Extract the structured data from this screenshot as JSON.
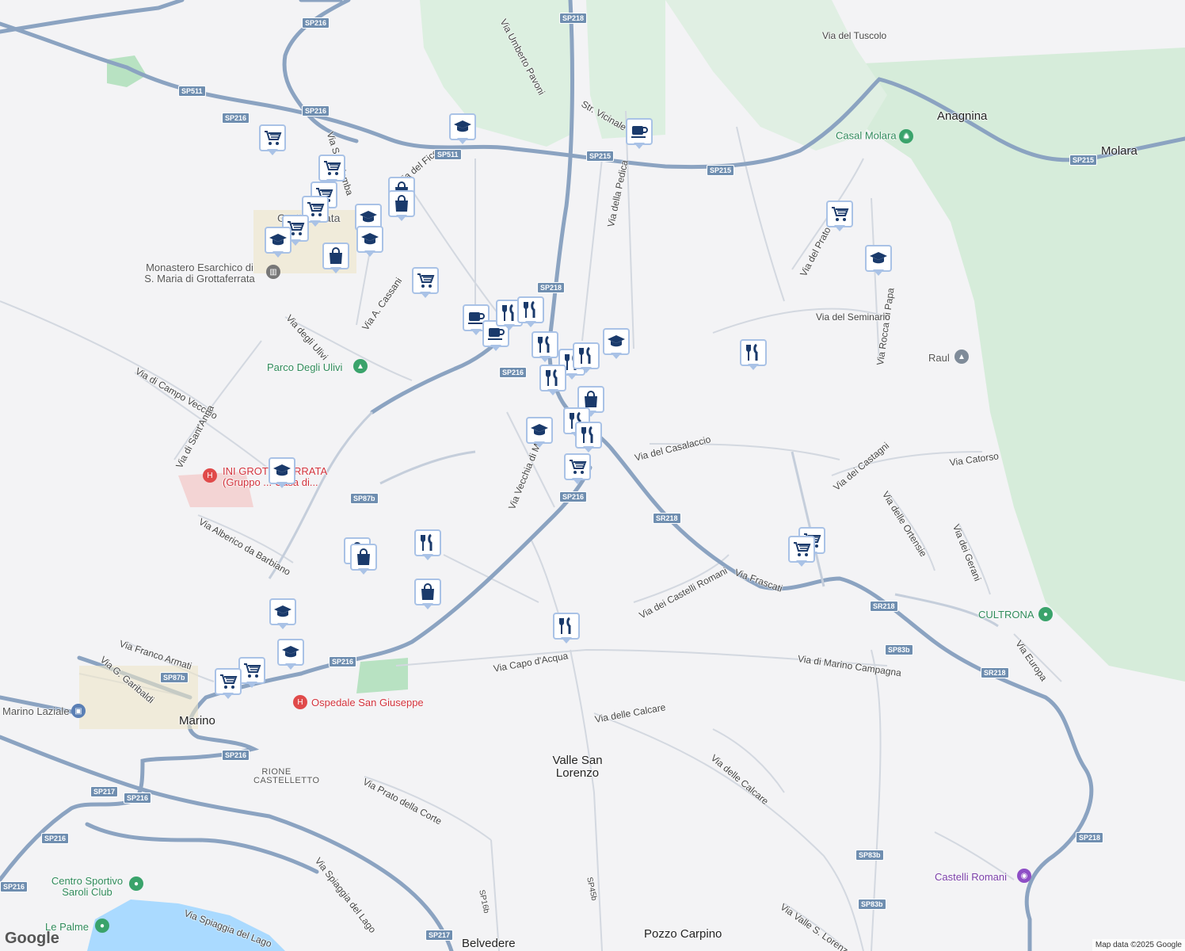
{
  "map": {
    "attribution": "Map data ©2025 Google",
    "logo": "Google"
  },
  "towns": [
    {
      "name": "Anagnina"
    },
    {
      "name": "Molara"
    },
    {
      "name": "Marino"
    },
    {
      "name": "Valle San Lorenzo"
    },
    {
      "name": "Pozzo Carpino"
    },
    {
      "name": "Belvedere"
    },
    {
      "name": "RIONE CASTELLETTO"
    }
  ],
  "streets": [
    "Via del Tuscolo",
    "Via Umberto Pavoni",
    "Str. Vicinale",
    "Via della Pedica",
    "Via del Prato",
    "Via Rocca di Papa",
    "Via del Seminario",
    "Via A. Cassani",
    "Via degli Ulivi",
    "Via di Campo Vecchio",
    "Via di Sant'Anna",
    "Via Alberico da Barbiano",
    "Via Vecchia di Marino",
    "Via del Casalaccio",
    "Via dei Castagni",
    "Via Catorso",
    "Via delle Ortensie",
    "Via dei Gerani",
    "Via Europa",
    "Via Frascati",
    "Via dei Castelli Romani",
    "Via Capo d'Acqua",
    "Via di Marino Campagna",
    "Via delle Calcare",
    "Via Franco Armati",
    "Via G. Garibaldi",
    "Via Prato della Corte",
    "Via Spiaggia del Lago",
    "Via Valle S. Lorenzo",
    "SP16b",
    "SP45b",
    "Via del Fico",
    "Via S. Colomba"
  ],
  "shields": [
    "SP216",
    "SP218",
    "SR218",
    "SP511",
    "SP215",
    "SP87b",
    "SP217",
    "SP83b"
  ],
  "pois": [
    {
      "name": "Casal Molara",
      "type": "park"
    },
    {
      "name": "Monastero Esarchico di S. Maria di Grottaferrata",
      "type": "landmark"
    },
    {
      "name": "Parco Degli Ulivi",
      "type": "park"
    },
    {
      "name": "INI GROTTAFERRATA (Gruppo ... Casa di...",
      "type": "hospital"
    },
    {
      "name": "Ospedale San Giuseppe",
      "type": "hospital"
    },
    {
      "name": "Raul",
      "type": "school"
    },
    {
      "name": "CULTRONA",
      "type": "place"
    },
    {
      "name": "Castelli Romani",
      "type": "attraction"
    },
    {
      "name": "Centro Sportivo Saroli Club",
      "type": "sport"
    },
    {
      "name": "Le Palme",
      "type": "place"
    },
    {
      "name": "Marino Laziale",
      "type": "station"
    },
    {
      "name": "Grottaferrata",
      "type": "town"
    }
  ],
  "markers": [
    {
      "type": "grocery"
    },
    {
      "type": "school"
    },
    {
      "type": "cafe"
    },
    {
      "type": "grocery"
    },
    {
      "type": "shopping"
    },
    {
      "type": "grocery"
    },
    {
      "type": "grocery"
    },
    {
      "type": "school"
    },
    {
      "type": "shopping"
    },
    {
      "type": "school"
    },
    {
      "type": "grocery"
    },
    {
      "type": "grocery"
    },
    {
      "type": "shopping"
    },
    {
      "type": "cafe"
    },
    {
      "type": "cafe"
    },
    {
      "type": "restaurant"
    },
    {
      "type": "restaurant"
    },
    {
      "type": "restaurant"
    },
    {
      "type": "school"
    },
    {
      "type": "restaurant"
    },
    {
      "type": "restaurant"
    },
    {
      "type": "restaurant"
    },
    {
      "type": "shopping"
    },
    {
      "type": "restaurant"
    },
    {
      "type": "restaurant"
    },
    {
      "type": "school"
    },
    {
      "type": "grocery"
    },
    {
      "type": "restaurant"
    },
    {
      "type": "school"
    },
    {
      "type": "grocery"
    },
    {
      "type": "grocery"
    },
    {
      "type": "grocery"
    },
    {
      "type": "shopping"
    },
    {
      "type": "restaurant"
    },
    {
      "type": "shopping"
    },
    {
      "type": "school"
    },
    {
      "type": "restaurant"
    },
    {
      "type": "school"
    },
    {
      "type": "school"
    },
    {
      "type": "grocery"
    },
    {
      "type": "grocery"
    },
    {
      "type": "school"
    },
    {
      "type": "shopping"
    }
  ],
  "colors": {
    "background": "#f3f3f5",
    "park": "#c9ead0",
    "forest": "#d7ecdd",
    "water": "#aadaff",
    "highway": "#8aa2c0",
    "road": "#c5cdd8",
    "marker_icon": "#1a3a6b",
    "marker_border": "#a9c2e6"
  }
}
